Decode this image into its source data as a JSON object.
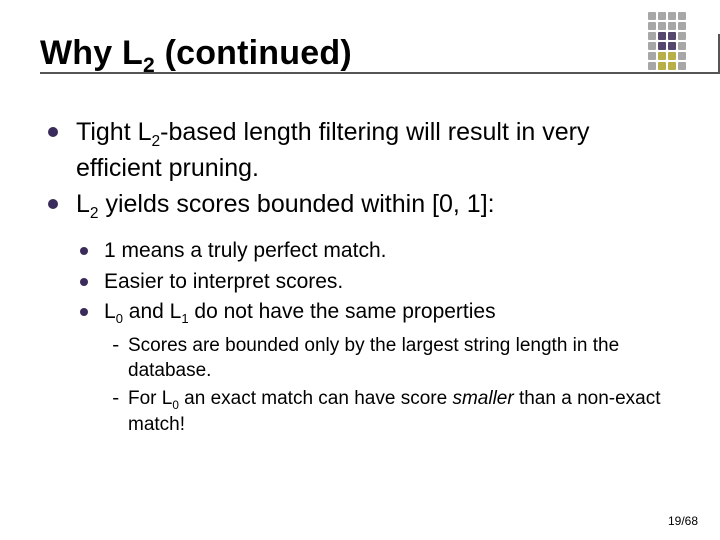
{
  "decoration": {
    "colors": [
      "#a7a7a7",
      "#a7a7a7",
      "#a7a7a7",
      "#a7a7a7",
      "#a7a7a7",
      "#a7a7a7",
      "#a7a7a7",
      "#a7a7a7",
      "#a7a7a7",
      "#55476e",
      "#55476e",
      "#a7a7a7",
      "#a7a7a7",
      "#55476e",
      "#55476e",
      "#a7a7a7",
      "#a7a7a7",
      "#b9af49",
      "#b9af49",
      "#a7a7a7",
      "#a7a7a7",
      "#b9af49",
      "#b9af49",
      "#a7a7a7"
    ]
  },
  "title": {
    "pre": "Why L",
    "sub": "2",
    "post": " (continued)"
  },
  "bullets": {
    "b1": {
      "a": "Tight L",
      "s1": "2",
      "b": "-based length filtering will result in very efficient pruning."
    },
    "b2": {
      "a": "L",
      "s1": "2",
      "b": " yields scores bounded within [0, 1]:"
    },
    "b2c": {
      "c1": "1 means a truly perfect match.",
      "c2": "Easier to interpret scores.",
      "c3": {
        "a": "L",
        "s1": "0",
        "b": " and L",
        "s2": "1",
        "c": " do not have the same properties"
      },
      "c3d": {
        "d1": "Scores are bounded only by the largest string length in the database.",
        "d2": {
          "a": "For L",
          "s1": "0",
          "b": " an exact match can have score ",
          "i": "smaller",
          "c": " than a non-exact match!"
        }
      }
    }
  },
  "page": "19/68"
}
